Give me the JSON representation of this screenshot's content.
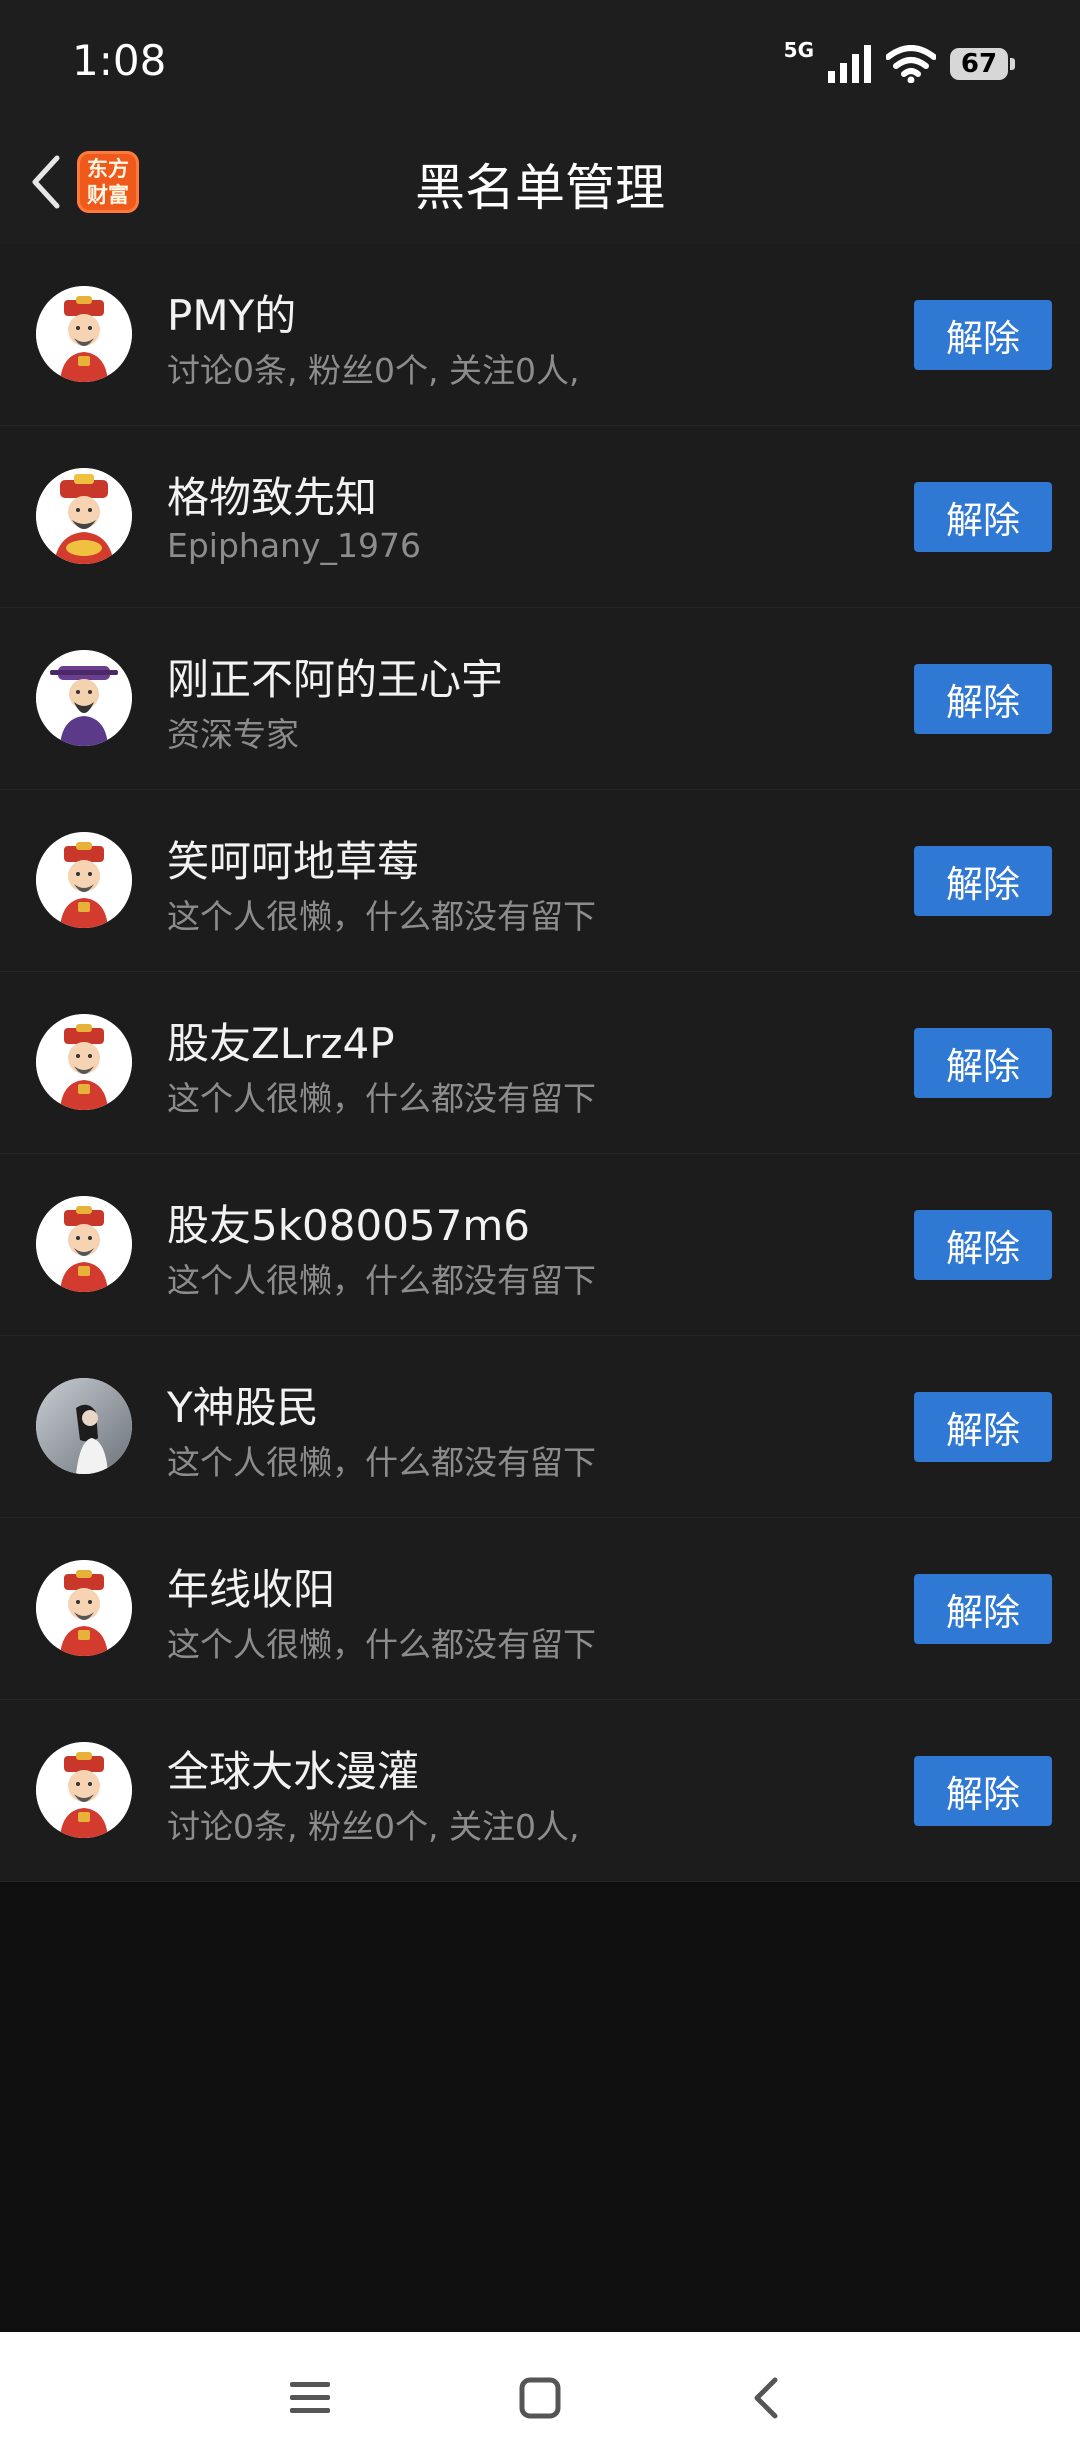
{
  "status_bar": {
    "time": "1:08",
    "network": "5G",
    "battery": "67"
  },
  "header": {
    "title": "黑名单管理",
    "logo_line1": "东方",
    "logo_line2": "财富"
  },
  "blocked_users": [
    {
      "name": "PMY的",
      "subtitle": "讨论0条, 粉丝0个, 关注0人,",
      "avatar": "god-of-wealth-avatar",
      "button": "解除"
    },
    {
      "name": "格物致先知",
      "subtitle": "Epiphany_1976",
      "avatar": "god-of-wealth-gold-avatar",
      "button": "解除"
    },
    {
      "name": "刚正不阿的王心宇",
      "subtitle": "资深专家",
      "avatar": "purple-official-avatar",
      "button": "解除"
    },
    {
      "name": "笑呵呵地草莓",
      "subtitle": "这个人很懒，什么都没有留下",
      "avatar": "god-of-wealth-avatar",
      "button": "解除"
    },
    {
      "name": "股友ZLrz4P",
      "subtitle": "这个人很懒，什么都没有留下",
      "avatar": "god-of-wealth-avatar",
      "button": "解除"
    },
    {
      "name": "股友5k080057m6",
      "subtitle": "这个人很懒，什么都没有留下",
      "avatar": "god-of-wealth-avatar",
      "button": "解除"
    },
    {
      "name": "Y神股民",
      "subtitle": "这个人很懒，什么都没有留下",
      "avatar": "photo-avatar",
      "button": "解除"
    },
    {
      "name": "年线收阳",
      "subtitle": "这个人很懒，什么都没有留下",
      "avatar": "god-of-wealth-avatar",
      "button": "解除"
    },
    {
      "name": "全球大水漫灌",
      "subtitle": "讨论0条, 粉丝0个, 关注0人,",
      "avatar": "god-of-wealth-avatar",
      "button": "解除"
    }
  ],
  "colors": {
    "button_blue": "#2f78d3",
    "list_bg": "#1c1c1d",
    "page_bg": "#0f0f0f",
    "logo_orange": "#ef5a1c"
  }
}
